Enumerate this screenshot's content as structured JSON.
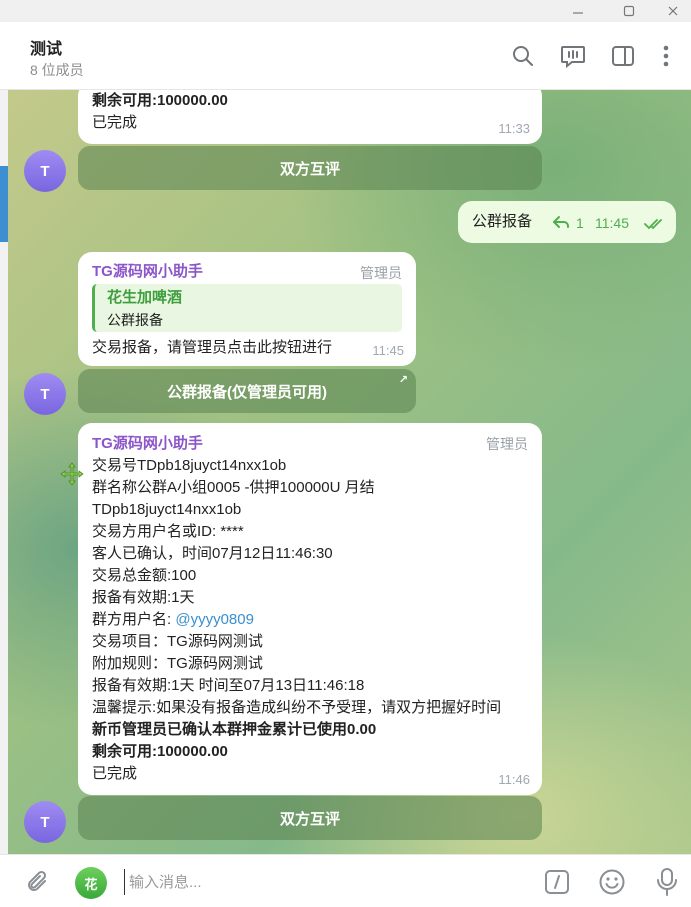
{
  "window": {
    "minimize": "—",
    "maximize": "☐",
    "close": "✕"
  },
  "header": {
    "title": "测试",
    "subtitle": "8 位成员"
  },
  "messages": {
    "top_partial": {
      "line1": "剩余可用:100000.00",
      "line2": "已完成",
      "time": "11:33"
    },
    "button1": "双方互评",
    "outgoing": {
      "text": "公群报备",
      "reply_count": "1",
      "time": "11:45"
    },
    "bot1": {
      "sender": "TG源码网小助手",
      "role": "管理员",
      "reply_name": "花生加啤酒",
      "reply_text": "公群报备",
      "text": "交易报备，请管理员点击此按钮进行",
      "time": "11:45"
    },
    "button2": "公群报备(仅管理员可用)",
    "bot2": {
      "sender": "TG源码网小助手",
      "role": "管理员",
      "lines": [
        "交易号TDpb18juyct14nxx1ob",
        "群名称公群A小组0005 -供押100000U 月结",
        "TDpb18juyct14nxx1ob",
        "交易方用户名或ID: ****",
        "客人已确认，时间07月12日11:46:30",
        "交易总金额:100",
        "报备有效期:1天"
      ],
      "group_user_label": "群方用户名: ",
      "group_user_link": "@yyyy0809",
      "lines2": [
        "交易项目：TG源码网测试",
        "附加规则：TG源码网测试",
        "报备有效期:1天  时间至07月13日11:46:18",
        "温馨提示:如果没有报备造成纠纷不予受理，请双方把握好时间"
      ],
      "bold1": "新币管理员已确认本群押金累计已使用0.00",
      "bold2": "剩余可用:100000.00",
      "done": "已完成",
      "time": "11:46"
    },
    "button3": "双方互评",
    "avatar_letter": "T"
  },
  "composer": {
    "avatar_text": "花",
    "placeholder": "输入消息..."
  },
  "colors": {
    "sender": "#8b56c9",
    "reply_accent": "#4fae4e",
    "link": "#3a8fd0",
    "avatar": "#8b76ea"
  },
  "icons": [
    "search-icon",
    "voice-chat-icon",
    "sidebar-toggle-icon",
    "more-vertical-icon",
    "attach-icon",
    "commands-icon",
    "emoji-icon",
    "microphone-icon",
    "reply-arrow-icon",
    "double-check-icon",
    "external-link-icon"
  ]
}
